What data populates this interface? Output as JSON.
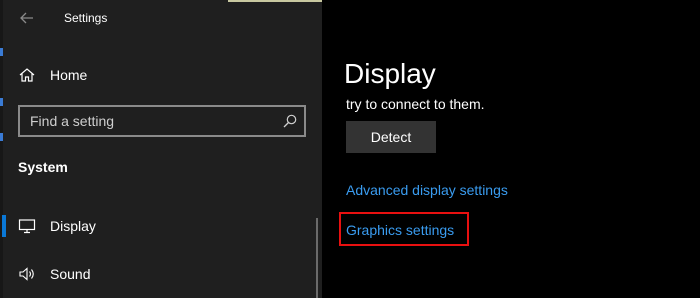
{
  "window": {
    "title": "Settings"
  },
  "sidebar": {
    "home_label": "Home",
    "search": {
      "placeholder": "Find a setting"
    },
    "section_heading": "System",
    "items": [
      {
        "label": "Display",
        "icon": "monitor-icon",
        "selected": true
      },
      {
        "label": "Sound",
        "icon": "speaker-icon",
        "selected": false
      }
    ]
  },
  "main": {
    "title": "Display",
    "description_fragment": "try to connect to them.",
    "detect_button": "Detect",
    "links": {
      "advanced": "Advanced display settings",
      "graphics": "Graphics settings"
    }
  },
  "colors": {
    "sidebar_bg": "#1f1f1f",
    "content_bg": "#000000",
    "link": "#3a9cf0",
    "accent": "#0a78d7",
    "highlight": "#e81010"
  }
}
